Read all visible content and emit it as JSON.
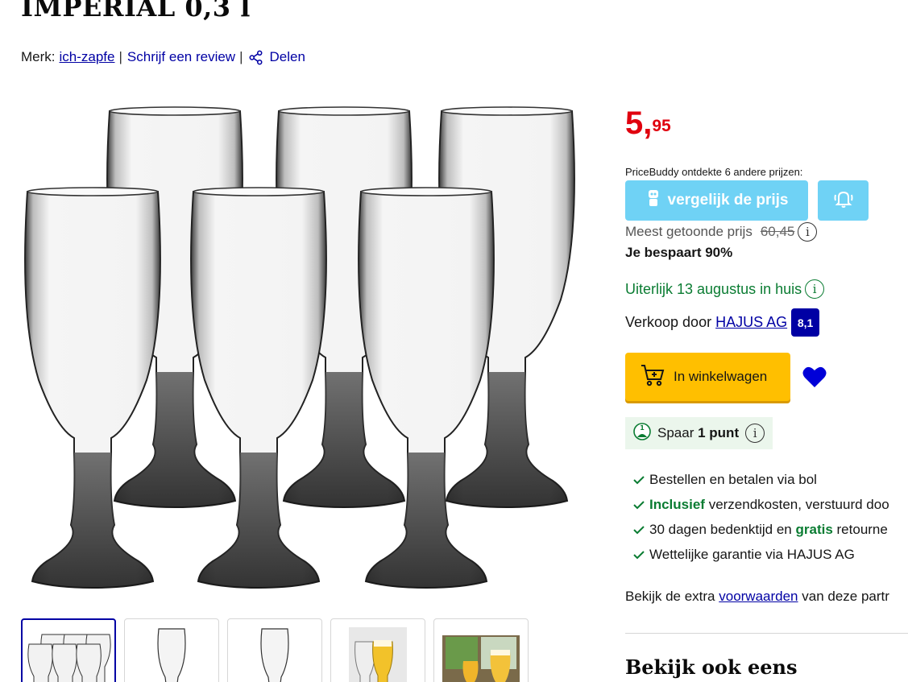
{
  "product": {
    "title": "IMPERIAL 0,3 l",
    "brand_label": "Merk:",
    "brand": "ich-zapfe",
    "review_link": "Schrijf een review",
    "share_link": "Delen"
  },
  "gallery": {
    "thumbnail_count": 5,
    "active_thumbnail": 1
  },
  "price": {
    "euros": "5,",
    "cents": "95",
    "color": "#e0000e"
  },
  "pricebuddy": {
    "note": "PriceBuddy ontdekte 6 andere prijzen:",
    "compare_label": "vergelijk de prijs",
    "color": "#6fd2f5",
    "bell_icon": "bell-alert-icon"
  },
  "reference_price": {
    "label": "Meest getoonde prijs",
    "old_price": "60,45",
    "info": "i",
    "savings": "Je bespaart 90%"
  },
  "delivery": {
    "text": "Uiterlijk 13 augustus in huis",
    "info": "i",
    "color": "#0a7c32"
  },
  "seller": {
    "label": "Verkoop door",
    "name": "HAJUS AG",
    "score": "8,1"
  },
  "cart": {
    "label": "In winkelwagen",
    "color": "#ffbf00"
  },
  "points": {
    "prefix": "Spaar",
    "value": "1 punt",
    "info": "i"
  },
  "usps": [
    {
      "pre": "Bestellen en betalen via bol",
      "bold": "",
      "post": ""
    },
    {
      "pre": "",
      "bold": "Inclusief",
      "post": " verzendkosten, verstuurd doo"
    },
    {
      "pre": "30 dagen bedenktijd en ",
      "bold": "gratis",
      "post": " retourne"
    },
    {
      "pre": "Wettelijke garantie via HAJUS AG",
      "bold": "",
      "post": ""
    }
  ],
  "terms": {
    "pre": "Bekijk de extra ",
    "link": "voorwaarden",
    "post": " van deze partr"
  },
  "see_also": "Bekijk ook eens",
  "brand_colors": {
    "link": "#0000a4",
    "text": "#161616"
  }
}
